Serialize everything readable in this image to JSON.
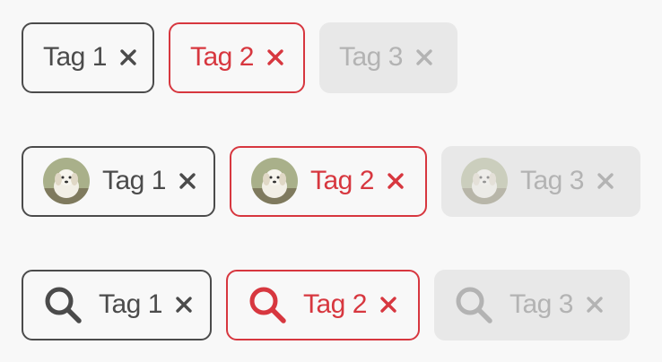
{
  "rows": [
    {
      "kind": "text",
      "tags": [
        {
          "label": "Tag 1",
          "state": "default"
        },
        {
          "label": "Tag 2",
          "state": "error"
        },
        {
          "label": "Tag 3",
          "state": "disabled"
        }
      ]
    },
    {
      "kind": "avatar",
      "tags": [
        {
          "label": "Tag 1",
          "state": "default"
        },
        {
          "label": "Tag 2",
          "state": "error"
        },
        {
          "label": "Tag 3",
          "state": "disabled"
        }
      ]
    },
    {
      "kind": "icon",
      "icon": "search-icon",
      "tags": [
        {
          "label": "Tag 1",
          "state": "default"
        },
        {
          "label": "Tag 2",
          "state": "error"
        },
        {
          "label": "Tag 3",
          "state": "disabled"
        }
      ]
    }
  ],
  "colors": {
    "default": "#4b4b4b",
    "error": "#d7373f",
    "disabled_text": "#b3b3b3",
    "disabled_bg": "#e8e8e8",
    "background": "#f8f8f8"
  }
}
